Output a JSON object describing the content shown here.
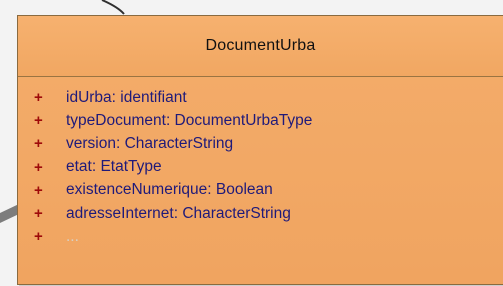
{
  "class": {
    "name": "DocumentUrba",
    "attributes": [
      {
        "visibility": "+",
        "text": "idUrba: identifiant"
      },
      {
        "visibility": "+",
        "text": "typeDocument: DocumentUrbaType"
      },
      {
        "visibility": "+",
        "text": "version: CharacterString"
      },
      {
        "visibility": "+",
        "text": "etat: EtatType"
      },
      {
        "visibility": "+",
        "text": "existenceNumerique: Boolean"
      },
      {
        "visibility": "+",
        "text": "adresseInternet: CharacterString"
      },
      {
        "visibility": "+",
        "text": "..."
      }
    ]
  },
  "colors": {
    "class_fill": "#f0a460",
    "border": "#8a6a3f",
    "visibility": "#9e0a0a",
    "attribute_text": "#1f1a7a"
  }
}
